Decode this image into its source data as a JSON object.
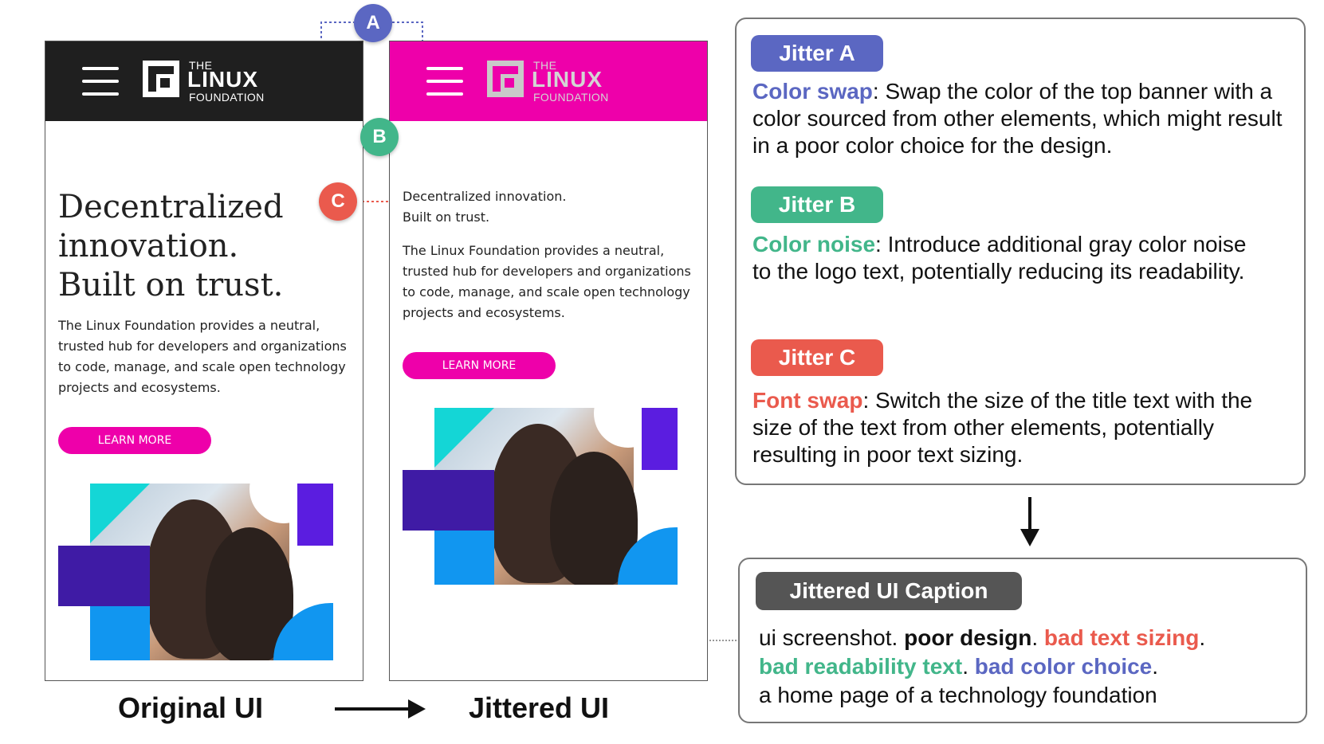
{
  "colors": {
    "magenta": "#ee00aa",
    "dark_banner": "#1f1f1f",
    "jitter_a": "#5b67c2",
    "jitter_b": "#42b68a",
    "jitter_c": "#ea5a4d",
    "caption_header": "#555555"
  },
  "original": {
    "logo": {
      "the": "THE",
      "linux": "LINUX",
      "foundation": "FOUNDATION"
    },
    "title": "Decentralized\ninnovation.\nBuilt on trust.",
    "body": "The Linux Foundation provides a neutral, trusted hub for developers and organizations to code, manage, and scale open technology projects and ecosystems.",
    "button": "LEARN MORE",
    "label": "Original UI"
  },
  "jittered": {
    "logo": {
      "the": "THE",
      "linux": "LINUX",
      "foundation": "FOUNDATION"
    },
    "title": "Decentralized innovation.\nBuilt on trust.",
    "body": "The Linux Foundation provides a neutral, trusted hub for developers and organizations to code, manage, and scale open technology projects and ecosystems.",
    "button": "LEARN MORE",
    "label": "Jittered UI"
  },
  "badges": {
    "a": "A",
    "b": "B",
    "c": "C"
  },
  "jitters": [
    {
      "pill": "Jitter A",
      "key": "Color swap",
      "text": ": Swap the color of the top banner with a color sourced from other elements, which might result in a poor color choice for the design."
    },
    {
      "pill": "Jitter B",
      "key": "Color noise",
      "text": ": Introduce additional gray color noise to the logo text, potentially reducing its readability."
    },
    {
      "pill": "Jitter C",
      "key": "Font swap",
      "text": ": Switch the size of the title text with the size of the text from other elements, potentially resulting in poor text sizing."
    }
  ],
  "caption": {
    "header": "Jittered UI Caption",
    "line1_a": "ui screenshot. ",
    "line1_b": "poor design",
    "line1_c": ". ",
    "line1_d": "bad text sizing",
    "line1_e": ".",
    "line2_a": "bad readability text",
    "line2_b": ". ",
    "line2_c": "bad color choice",
    "line2_d": ".",
    "line3": "a home page of a technology foundation"
  }
}
